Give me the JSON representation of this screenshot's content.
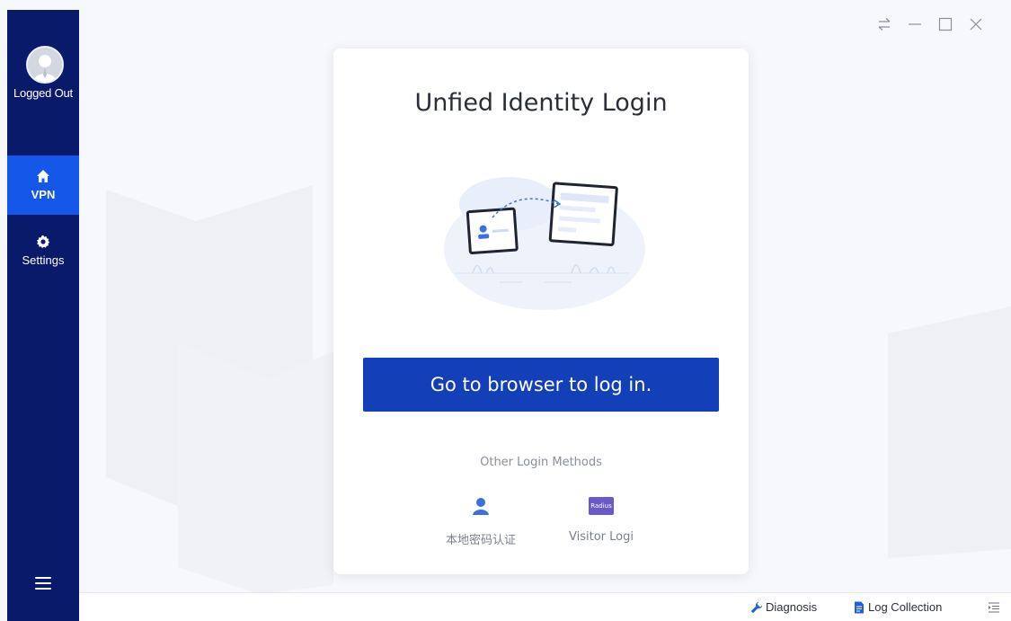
{
  "window": {
    "controls": [
      {
        "icon": "swap-icon"
      },
      {
        "icon": "minimize-icon"
      },
      {
        "icon": "maximize-icon"
      },
      {
        "icon": "close-icon"
      }
    ]
  },
  "sidebar": {
    "status": "Logged Out",
    "items": [
      {
        "label": "VPN",
        "icon": "home-icon",
        "active": true
      },
      {
        "label": "Settings",
        "icon": "gear-icon",
        "active": false
      }
    ],
    "menu_icon": "menu-icon"
  },
  "card": {
    "title": "Unfied Identity Login",
    "button_label": "Go to browser to log in.",
    "other_methods_label": "Other Login Methods",
    "methods": [
      {
        "label": "本地密码认证",
        "icon": "user-icon"
      },
      {
        "label": "Visitor Logi",
        "icon": "radius-icon",
        "badge_text": "Radius"
      }
    ]
  },
  "bottom_bar": {
    "diagnosis_label": "Diagnosis",
    "log_collection_label": "Log Collection"
  },
  "colors": {
    "sidebar": "#0a1a6b",
    "active_nav": "#1557e8",
    "primary_button": "#1340b8",
    "radius_badge": "#6b58c9"
  }
}
